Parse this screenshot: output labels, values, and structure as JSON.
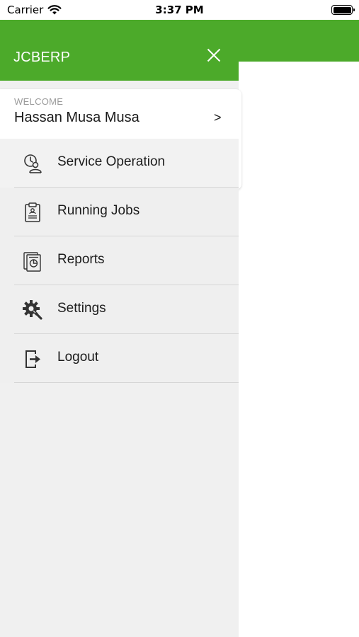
{
  "status_bar": {
    "carrier": "Carrier",
    "time": "3:37 PM"
  },
  "app": {
    "title": "JCBERP",
    "accent_color": "#4caa2a"
  },
  "user": {
    "welcome_label": "WELCOME",
    "name": "Hassan Musa Musa",
    "chevron": ">"
  },
  "menu": {
    "items": [
      {
        "label": "Service Operation",
        "icon": "service-operation-icon"
      },
      {
        "label": "Running Jobs",
        "icon": "clipboard-icon"
      },
      {
        "label": "Reports",
        "icon": "reports-icon"
      },
      {
        "label": "Settings",
        "icon": "gear-icon"
      },
      {
        "label": "Logout",
        "icon": "logout-icon"
      }
    ]
  }
}
